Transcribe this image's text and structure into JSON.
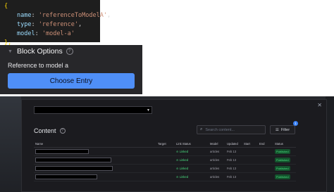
{
  "code_snippet": {
    "open_brace": "{",
    "close_brace": "},",
    "lines": [
      {
        "key": "name",
        "value": "'referenceToModelA'"
      },
      {
        "key": "type",
        "value": "'reference'"
      },
      {
        "key": "model",
        "value": "'model-a'"
      }
    ]
  },
  "block_options": {
    "title": "Block Options",
    "help_glyph": "?",
    "field_label": "Reference to model a",
    "choose_button": "Choose Entry",
    "accent_color": "#4f8ff7"
  },
  "modal": {
    "close_glyph": "✕",
    "content_title": "Content",
    "search_placeholder": "Search content...",
    "filter_label": "Filter",
    "filter_count": "1",
    "columns": [
      "Name",
      "Target",
      "Link Status",
      "Model",
      "Updated",
      "Start",
      "End",
      "Status"
    ],
    "rows": [
      {
        "link_status": "Linked",
        "model": "articles",
        "updated": "Feb 13",
        "status": "Published"
      },
      {
        "link_status": "Linked",
        "model": "articles",
        "updated": "Feb 13",
        "status": "Published"
      },
      {
        "link_status": "Linked",
        "model": "articles",
        "updated": "Feb 13",
        "status": "Published"
      },
      {
        "link_status": "Linked",
        "model": "articles",
        "updated": "Feb 13",
        "status": "Published"
      }
    ],
    "status_color": "#4ade80"
  }
}
